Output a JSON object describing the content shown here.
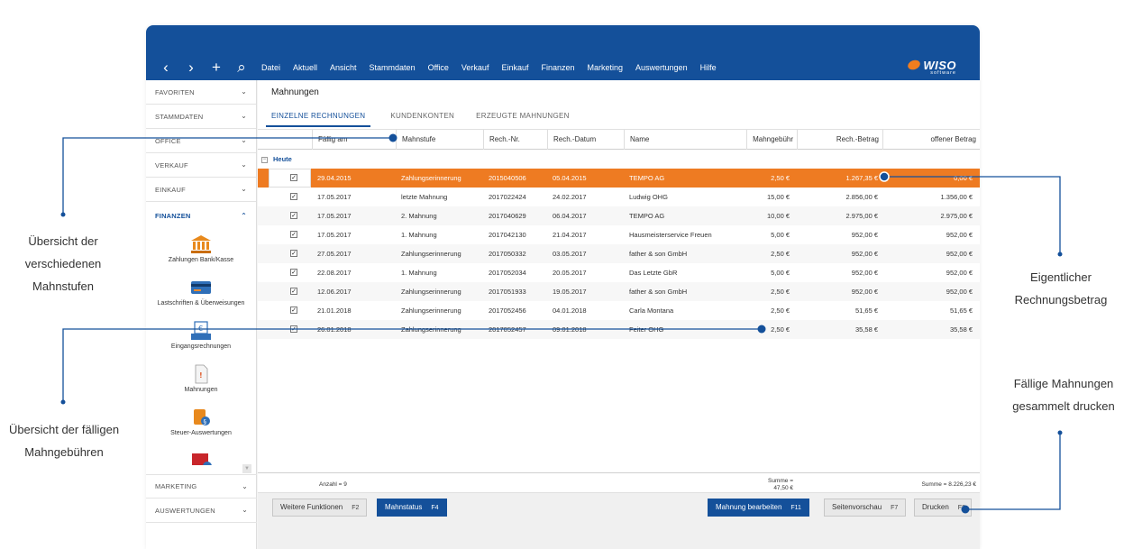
{
  "toolbar": {
    "back_icon": "‹",
    "forward_icon": "›",
    "add_icon": "+",
    "search_icon": "⌕"
  },
  "menu": [
    "Datei",
    "Aktuell",
    "Ansicht",
    "Stammdaten",
    "Office",
    "Verkauf",
    "Einkauf",
    "Finanzen",
    "Marketing",
    "Auswertungen",
    "Hilfe"
  ],
  "logo": {
    "word": "WISO",
    "sub": "software"
  },
  "sidebar": {
    "sections_top": [
      {
        "label": "FAVORITEN",
        "chevron": "⌄"
      },
      {
        "label": "STAMMDATEN",
        "chevron": "⌄"
      },
      {
        "label": "OFFICE",
        "chevron": "⌄"
      },
      {
        "label": "VERKAUF",
        "chevron": "⌄"
      },
      {
        "label": "EINKAUF",
        "chevron": "⌄"
      }
    ],
    "active_section": {
      "label": "FINANZEN",
      "chevron": "⌃"
    },
    "tools": [
      {
        "label": "Zahlungen Bank/Kasse",
        "icon": "bank-icon"
      },
      {
        "label": "Lastschriften & Überweisungen",
        "icon": "card-icon"
      },
      {
        "label": "Eingangsrechnungen",
        "icon": "incoming-invoice-icon"
      },
      {
        "label": "Mahnungen",
        "icon": "reminder-document-icon"
      },
      {
        "label": "Steuer-Auswertungen",
        "icon": "tax-scroll-icon"
      }
    ],
    "sections_bottom": [
      {
        "label": "MARKETING",
        "chevron": "⌄"
      },
      {
        "label": "AUSWERTUNGEN",
        "chevron": "⌄"
      }
    ]
  },
  "main": {
    "title": "Mahnungen",
    "tabs": [
      "EINZELNE RECHNUNGEN",
      "KUNDENKONTEN",
      "ERZEUGTE MAHNUNGEN"
    ],
    "columns": [
      "Fällig am",
      "Mahnstufe",
      "Rech.-Nr.",
      "Rech.-Datum",
      "Name",
      "Mahngebühr",
      "Rech.-Betrag",
      "offener Betrag"
    ],
    "group_label": "Heute",
    "group_toggle": "−",
    "check_mark": "✓",
    "rows": [
      {
        "due": "29.04.2015",
        "level": "Zahlungserinnerung",
        "number": "2015040506",
        "date": "05.04.2015",
        "name": "TEMPO AG",
        "fee": "2,50 €",
        "amount": "1.267,35 €",
        "open": "0,00 €",
        "selected": true
      },
      {
        "due": "17.05.2017",
        "level": "letzte Mahnung",
        "number": "2017022424",
        "date": "24.02.2017",
        "name": "Ludwig OHG",
        "fee": "15,00 €",
        "amount": "2.856,00 €",
        "open": "1.356,00 €"
      },
      {
        "due": "17.05.2017",
        "level": "2. Mahnung",
        "number": "2017040629",
        "date": "06.04.2017",
        "name": "TEMPO AG",
        "fee": "10,00 €",
        "amount": "2.975,00 €",
        "open": "2.975,00 €"
      },
      {
        "due": "17.05.2017",
        "level": "1. Mahnung",
        "number": "2017042130",
        "date": "21.04.2017",
        "name": "Hausmeisterservice Freuen",
        "fee": "5,00 €",
        "amount": "952,00 €",
        "open": "952,00 €"
      },
      {
        "due": "27.05.2017",
        "level": "Zahlungserinnerung",
        "number": "2017050332",
        "date": "03.05.2017",
        "name": "father & son GmbH",
        "fee": "2,50 €",
        "amount": "952,00 €",
        "open": "952,00 €"
      },
      {
        "due": "22.08.2017",
        "level": "1. Mahnung",
        "number": "2017052034",
        "date": "20.05.2017",
        "name": "Das Letzte GbR",
        "fee": "5,00 €",
        "amount": "952,00 €",
        "open": "952,00 €"
      },
      {
        "due": "12.06.2017",
        "level": "Zahlungserinnerung",
        "number": "2017051933",
        "date": "19.05.2017",
        "name": "father & son GmbH",
        "fee": "2,50 €",
        "amount": "952,00 €",
        "open": "952,00 €"
      },
      {
        "due": "21.01.2018",
        "level": "Zahlungserinnerung",
        "number": "2017052456",
        "date": "04.01.2018",
        "name": "Carla Montana",
        "fee": "2,50 €",
        "amount": "51,65 €",
        "open": "51,65 €"
      },
      {
        "due": "26.01.2018",
        "level": "Zahlungserinnerung",
        "number": "2017052457",
        "date": "09.01.2018",
        "name": "Feiter OHG",
        "fee": "2,50 €",
        "amount": "35,58 €",
        "open": "35,58 €"
      }
    ],
    "totals": {
      "count": "Anzahl = 9",
      "fee_sum_label": "Summe =",
      "fee_sum_value": "47,50 €",
      "open_sum": "Summe = 8.226,23 €"
    }
  },
  "actions": {
    "more": {
      "label": "Weitere Funktionen",
      "key": "F2"
    },
    "status": {
      "label": "Mahnstatus",
      "key": "F4"
    },
    "edit": {
      "label": "Mahnung bearbeiten",
      "key": "F11"
    },
    "preview": {
      "label": "Seitenvorschau",
      "key": "F7"
    },
    "print": {
      "label": "Drucken",
      "key": "F8"
    }
  },
  "callouts": {
    "levels": [
      "Übersicht der",
      "verschiedenen",
      "Mahnstufen"
    ],
    "fees": [
      "Übersicht der fälligen",
      "Mahngebühren"
    ],
    "amount": [
      "Eigentlicher",
      "Rechnungsbetrag"
    ],
    "print": [
      "Fällige Mahnungen",
      "gesammelt drucken"
    ]
  },
  "colors": {
    "brand_blue": "#14509a",
    "selection_orange": "#ee7b22",
    "logo_orange": "#f07d1f"
  }
}
